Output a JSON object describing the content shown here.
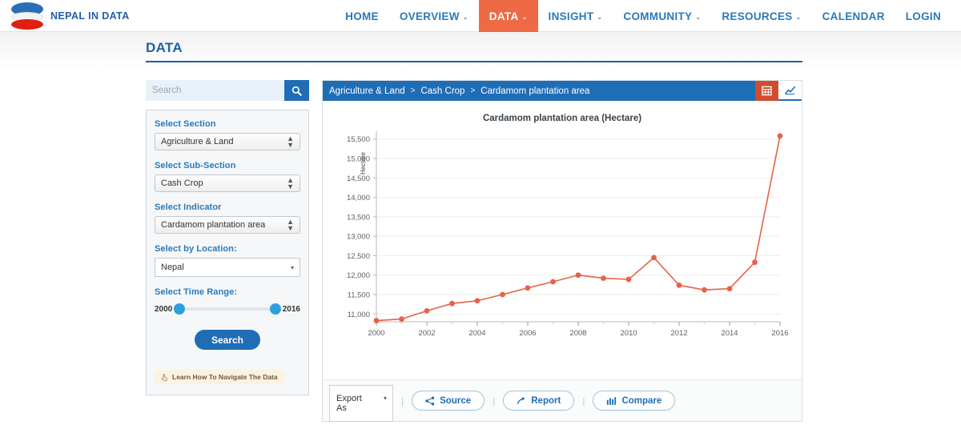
{
  "brand": {
    "name": "NEPAL IN DATA",
    "logo_icon": "nepal-in-data-logo"
  },
  "nav": {
    "items": [
      {
        "label": "HOME",
        "has_caret": false,
        "active": false
      },
      {
        "label": "OVERVIEW",
        "has_caret": true,
        "active": false
      },
      {
        "label": "DATA",
        "has_caret": true,
        "active": true
      },
      {
        "label": "INSIGHT",
        "has_caret": true,
        "active": false
      },
      {
        "label": "COMMUNITY",
        "has_caret": true,
        "active": false
      },
      {
        "label": "RESOURCES",
        "has_caret": true,
        "active": false
      },
      {
        "label": "CALENDAR",
        "has_caret": false,
        "active": false
      },
      {
        "label": "LOGIN",
        "has_caret": false,
        "active": false
      }
    ],
    "active_color": "#ed6a45",
    "link_color": "#2a7ab9"
  },
  "page": {
    "title": "DATA"
  },
  "search": {
    "placeholder": "Search",
    "value": "",
    "icon": "search-icon"
  },
  "filters": {
    "section": {
      "label": "Select Section",
      "value": "Agriculture & Land"
    },
    "sub_section": {
      "label": "Select Sub-Section",
      "value": "Cash Crop"
    },
    "indicator": {
      "label": "Select Indicator",
      "value": "Cardamom plantation area"
    },
    "location": {
      "label": "Select by Location:",
      "value": "Nepal"
    },
    "time_range": {
      "label": "Select Time Range:",
      "start": "2000",
      "end": "2016"
    },
    "submit_label": "Search",
    "learn_label": "Learn How To Navigate The Data",
    "learn_icon": "hand-pointer-icon"
  },
  "breadcrumb": {
    "items": [
      "Agriculture & Land",
      "Cash Crop",
      "Cardamom plantation area"
    ],
    "separator": ">"
  },
  "view_toggles": [
    {
      "name": "table-view",
      "icon": "table-icon",
      "active": true
    },
    {
      "name": "chart-view",
      "icon": "line-chart-icon",
      "active": false
    }
  ],
  "bottom_toolbar": {
    "export_label": "Export As",
    "export_line1": "Export",
    "export_line2": "As",
    "buttons": [
      {
        "label": "Source",
        "icon": "share-icon"
      },
      {
        "label": "Report",
        "icon": "arrow-up-right-icon"
      },
      {
        "label": "Compare",
        "icon": "bar-chart-icon"
      }
    ],
    "divider": "|"
  },
  "chart_data": {
    "type": "line",
    "title": "Cardamom plantation area (Hectare)",
    "xlabel": "",
    "ylabel": "Hectare",
    "unit": "Hectare",
    "series_color": "#e8614a",
    "grid": true,
    "legend": false,
    "xlim": [
      2000,
      2016
    ],
    "ylim": [
      10800,
      15700
    ],
    "xticks": [
      2000,
      2002,
      2004,
      2006,
      2008,
      2010,
      2012,
      2014,
      2016
    ],
    "yticks": [
      11000,
      11500,
      12000,
      12500,
      13000,
      13500,
      14000,
      14500,
      15000,
      15500
    ],
    "ytick_labels": [
      "11,000",
      "11,500",
      "12,000",
      "12,500",
      "13,000",
      "13,500",
      "14,000",
      "14,500",
      "15,000",
      "15,500"
    ],
    "x": [
      2000,
      2001,
      2002,
      2003,
      2004,
      2005,
      2006,
      2007,
      2008,
      2009,
      2010,
      2011,
      2012,
      2013,
      2014,
      2015,
      2016
    ],
    "values": [
      10830,
      10870,
      11080,
      11270,
      11340,
      11500,
      11670,
      11830,
      12000,
      11920,
      11890,
      12450,
      11740,
      11620,
      11650,
      12330,
      15580
    ],
    "series": [
      {
        "name": "Cardamom plantation area",
        "values": [
          10830,
          10870,
          11080,
          11270,
          11340,
          11500,
          11670,
          11830,
          12000,
          11920,
          11890,
          12450,
          11740,
          11620,
          11650,
          12330,
          15580
        ]
      }
    ]
  }
}
